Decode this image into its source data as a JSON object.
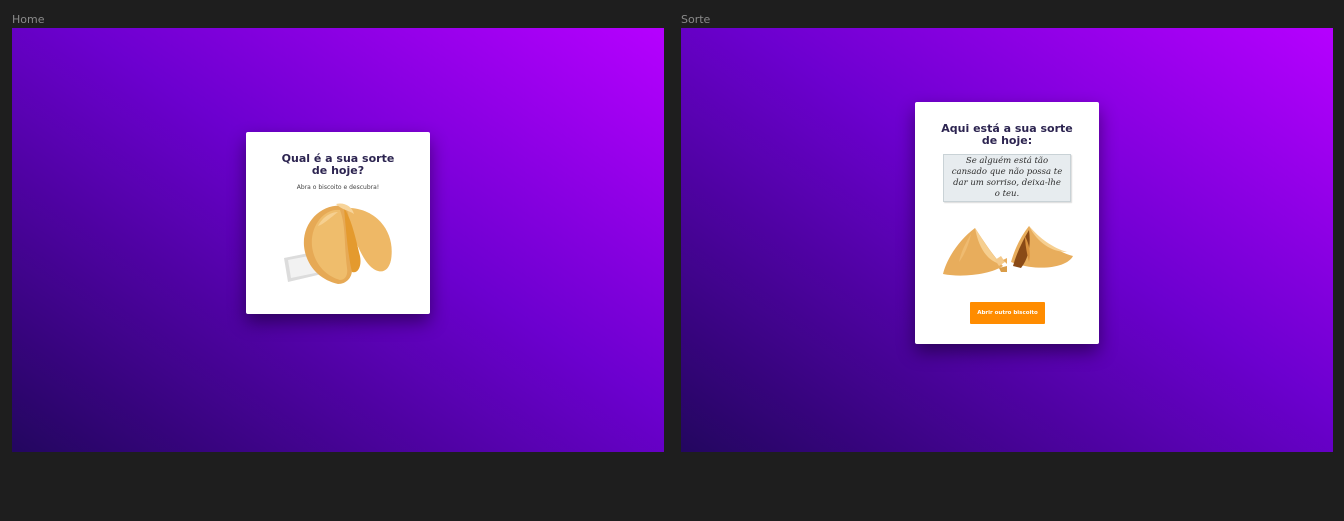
{
  "frames": {
    "home": {
      "label": "Home",
      "title": "Qual é a sua sorte de hoje?",
      "subtitle": "Abra o biscoito e descubra!"
    },
    "sorte": {
      "label": "Sorte",
      "title": "Aqui está a sua sorte de hoje:",
      "fortune": "Se alguém está tão cansado que não possa te dar um sorriso, deixa-lhe o teu.",
      "button_label": "Abrir outro biscoito"
    }
  },
  "colors": {
    "background": "#1e1e1e",
    "gradient_dark": "#23065f",
    "gradient_light": "#b600ff",
    "button": "#ff8c00",
    "title_text": "#2c2450"
  },
  "icons": {
    "home_image": "fortune-cookie-closed-icon",
    "sorte_image": "fortune-cookie-broken-icon"
  }
}
